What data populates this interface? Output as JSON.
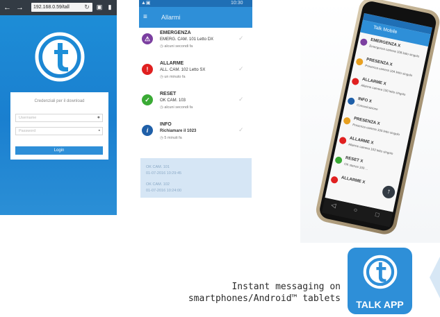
{
  "browser": {
    "url": "192.168.0.59/tall",
    "card_title": "Credenziali per il download",
    "username_placeholder": "Username",
    "password_placeholder": "Password",
    "login_label": "Login"
  },
  "allarmi": {
    "status_time": "10:30",
    "title": "Allarmi",
    "items": [
      {
        "title": "EMERGENZA",
        "sub": "EMERG. CAM. 101 Letto DX",
        "time": "◷ alcuni secondi fa",
        "color": "#7b3fa0",
        "icon": "warning-triangle-icon"
      },
      {
        "title": "ALLARME",
        "sub": "ALL. CAM. 102 Letto SX",
        "time": "◷ un minuto fa",
        "color": "#e02020",
        "icon": "exclamation-icon"
      },
      {
        "title": "RESET",
        "sub": "OK CAM. 103",
        "time": "◷ alcuni secondi fa",
        "color": "#3aaa35",
        "icon": "check-icon"
      },
      {
        "title": "INFO",
        "sub": "Richiamare il 1023",
        "time": "◷ 5 minuti fa",
        "color": "#1f5fa8",
        "icon": "info-icon"
      }
    ],
    "history": [
      {
        "line1": "OK CAM. 101",
        "line2": "01-07-2016 10:29:45"
      },
      {
        "line1": "OK CAM. 102",
        "line2": "01-07-2016 10:24:00"
      }
    ]
  },
  "phone": {
    "app_title": "Talk Mobile",
    "entries": [
      {
        "title": "EMERGENZA X",
        "sub": "Emergenza camera 108 letto singolo",
        "color": "#7b3fa0"
      },
      {
        "title": "PRESENZA X",
        "sub": "Presenza camera 104 letto singolo",
        "color": "#e8a020"
      },
      {
        "title": "ALLARME X",
        "sub": "Allarme camera 100 letto singolo",
        "color": "#e02020"
      },
      {
        "title": "INFO X",
        "sub": "Comunicazione",
        "color": "#1f5fa8"
      },
      {
        "title": "PRESENZA X",
        "sub": "Presenza camera 100 letto singolo",
        "color": "#e8a020"
      },
      {
        "title": "ALLARME X",
        "sub": "Allarme camera 103 letto singolo",
        "color": "#e02020"
      },
      {
        "title": "RESET X",
        "sub": "OK stanza 100 ...",
        "color": "#3aaa35"
      },
      {
        "title": "ALLARME X",
        "sub": "",
        "color": "#e02020"
      }
    ]
  },
  "footer": {
    "line1": "Instant messaging on",
    "line2": "smartphones/Android™ tablets",
    "app_label": "TALK APP"
  },
  "colors": {
    "brand": "#2e8fd8",
    "dark": "#333b44"
  }
}
